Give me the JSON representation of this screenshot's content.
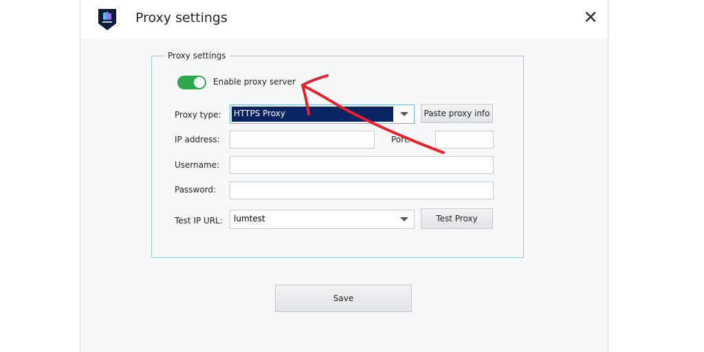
{
  "window": {
    "title": "Proxy settings",
    "close_icon": "close-icon",
    "logo_icon": "shield-logo-icon"
  },
  "group": {
    "legend": "Proxy settings",
    "enable_proxy": {
      "label": "Enable proxy server",
      "on": true,
      "color": "#2ea84f"
    },
    "proxy_type": {
      "label": "Proxy type:",
      "value": "HTTPS Proxy"
    },
    "paste_button": "Paste proxy info",
    "ip": {
      "label": "IP address:",
      "value": ""
    },
    "port": {
      "label": "Port:",
      "value": ""
    },
    "username": {
      "label": "Username:",
      "value": ""
    },
    "password": {
      "label": "Password:",
      "value": ""
    },
    "test_url": {
      "label": "Test IP URL:",
      "value": "lumtest"
    },
    "test_button": "Test Proxy"
  },
  "save_button": "Save",
  "annotation": {
    "color": "#e8202a"
  }
}
